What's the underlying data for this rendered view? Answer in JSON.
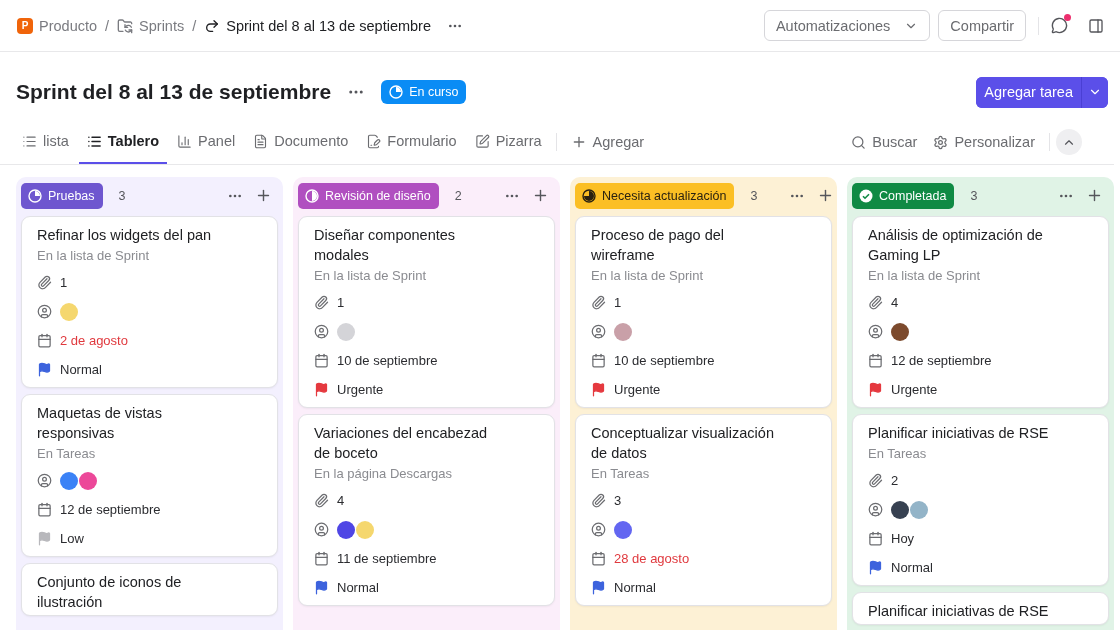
{
  "breadcrumb": {
    "logo": "P",
    "separator": "/",
    "items": [
      {
        "label": "Producto"
      },
      {
        "label": "Sprints"
      },
      {
        "label": "Sprint del 8 al 13 de septiembre"
      }
    ]
  },
  "header_actions": {
    "automations": "Automatizaciones",
    "share": "Compartir",
    "notification": true
  },
  "title": "Sprint del 8 al 13 de septiembre",
  "status": "En curso",
  "add_task": "Agregar tarea",
  "tabs": [
    {
      "label": "lista",
      "selected": false
    },
    {
      "label": "Tablero",
      "selected": true
    },
    {
      "label": "Panel",
      "selected": false
    },
    {
      "label": "Documento",
      "selected": false
    },
    {
      "label": "Formulario",
      "selected": false
    },
    {
      "label": "Pizarra",
      "selected": false
    }
  ],
  "add_view": "Agregar",
  "search": "Buscar",
  "customize": "Personalizar",
  "columns": [
    {
      "name": "Pruebas",
      "kind": "progress",
      "color": "#6e56cf",
      "count": "3",
      "cards": [
        {
          "title": "Refinar los widgets del pan",
          "location": "En la lista de Sprint",
          "attachments": "1",
          "assignees": [
            {
              "color": "#f5d76e"
            }
          ],
          "date": "2 de agosto",
          "overdue": true,
          "priority": {
            "label": "Normal",
            "kind": "normal"
          }
        },
        {
          "title": "Maquetas de vistas responsivas",
          "location": "En Tareas",
          "assignees": [
            {
              "color": "#3b82f6"
            },
            {
              "color": "#ec4899"
            }
          ],
          "date": "12 de septiembre",
          "overdue": false,
          "priority": {
            "label": "Low",
            "kind": "low"
          }
        },
        {
          "title": "Conjunto de iconos de ilustración"
        }
      ]
    },
    {
      "name": "Revisión de diseño",
      "kind": "half",
      "color": "#b04fc0",
      "count": "2",
      "cards": [
        {
          "title": "Diseñar componentes modales",
          "location": "En la lista de Sprint",
          "attachments": "1",
          "assignees": [
            {
              "color": "#d4d4d8"
            }
          ],
          "date": "10 de septiembre",
          "overdue": false,
          "priority": {
            "label": "Urgente",
            "kind": "urgent"
          }
        },
        {
          "title": "Variaciones del encabezad de boceto",
          "location": "En la página Descargas",
          "attachments": "4",
          "assignees": [
            {
              "color": "#4f46e5"
            },
            {
              "color": "#f5d76e"
            }
          ],
          "date": "11 de septiembre",
          "overdue": false,
          "priority": {
            "label": "Normal",
            "kind": "normal"
          }
        }
      ]
    },
    {
      "name": "Necesita actualización",
      "kind": "quarter",
      "color": "#fbbf24",
      "count": "3",
      "cards": [
        {
          "title": "Proceso de pago del wireframe",
          "location": "En la lista de Sprint",
          "attachments": "1",
          "assignees": [
            {
              "color": "#c9a0a8"
            }
          ],
          "date": "10 de septiembre",
          "overdue": false,
          "priority": {
            "label": "Urgente",
            "kind": "urgent"
          }
        },
        {
          "title": "Conceptualizar visualización de datos",
          "location": "En Tareas",
          "attachments": "3",
          "assignees": [
            {
              "color": "#6366f1"
            }
          ],
          "date": "28 de agosto",
          "overdue": true,
          "priority": {
            "label": "Normal",
            "kind": "normal"
          }
        }
      ]
    },
    {
      "name": "Completada",
      "kind": "check",
      "color": "#0f8a44",
      "count": "3",
      "cards": [
        {
          "title": "Análisis de optimización de Gaming LP",
          "location": "En la lista de Sprint",
          "attachments": "4",
          "assignees": [
            {
              "color": "#7c4a2d"
            }
          ],
          "date": "12 de septiembre",
          "overdue": false,
          "priority": {
            "label": "Urgente",
            "kind": "urgent"
          }
        },
        {
          "title": "Planificar iniciativas de RSE",
          "location": "En Tareas",
          "attachments": "2",
          "assignees": [
            {
              "color": "#374151"
            },
            {
              "color": "#93b4c8"
            }
          ],
          "date": "Hoy",
          "overdue": false,
          "priority": {
            "label": "Normal",
            "kind": "normal"
          }
        },
        {
          "title": "Planificar iniciativas de RSE"
        }
      ]
    }
  ]
}
